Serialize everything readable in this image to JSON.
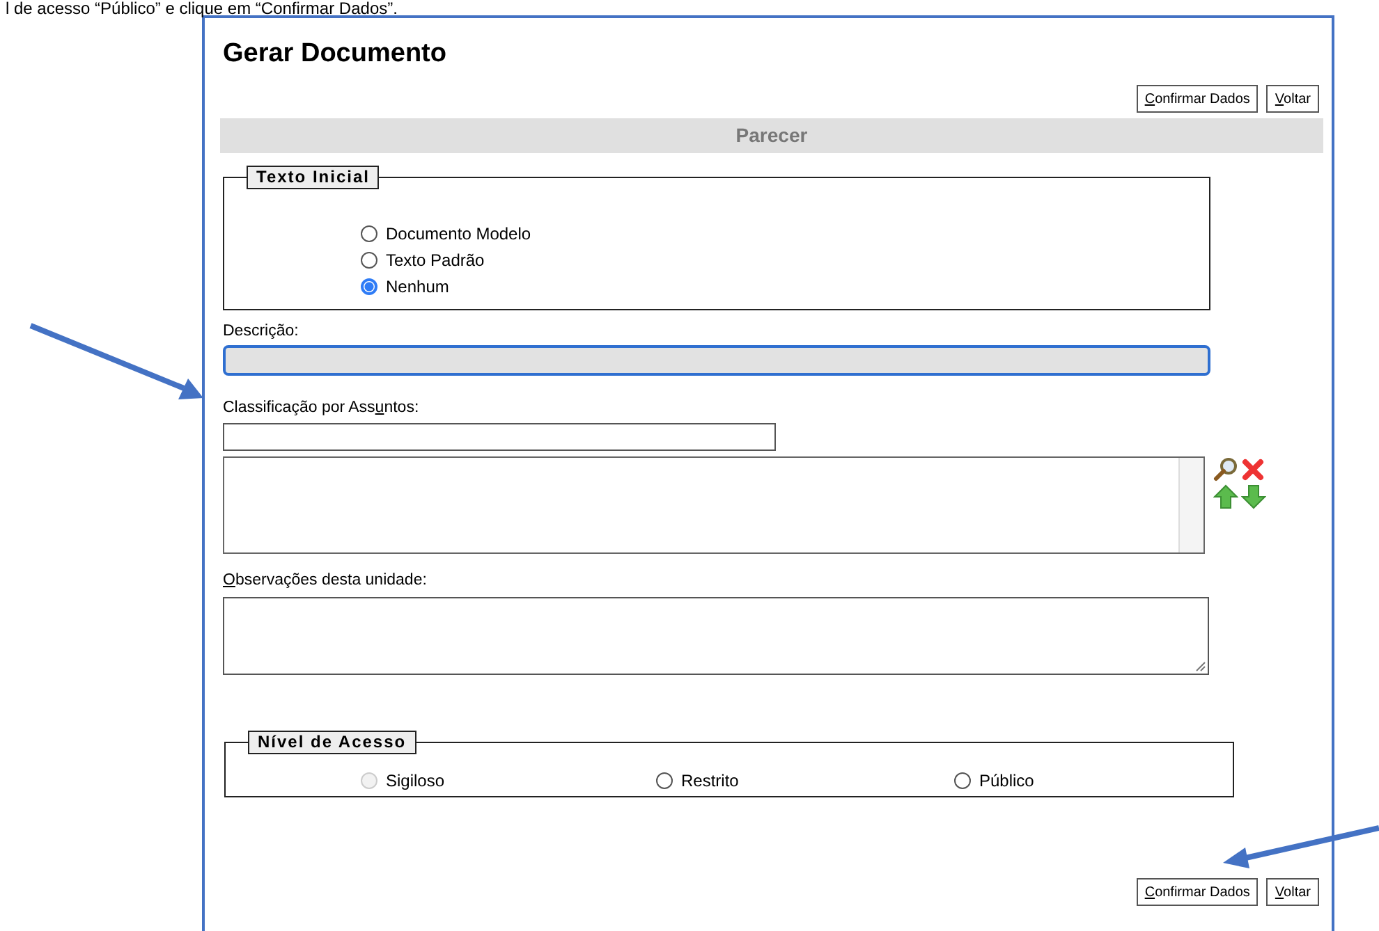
{
  "instruction_text": "l de acesso “Público” e clique em “Confirmar Dados”.",
  "window": {
    "title": "Gerar Documento"
  },
  "top_buttons": [
    {
      "key": "C",
      "after": "onfirmar Dados"
    },
    {
      "key": "V",
      "after": "oltar"
    }
  ],
  "section_header": "Parecer",
  "texto_inicial": {
    "legend": "Texto Inicial",
    "options": [
      {
        "label": "Documento Modelo",
        "selected": false
      },
      {
        "label": "Texto Padrão",
        "selected": false
      },
      {
        "label": "Nenhum",
        "selected": true
      }
    ]
  },
  "descricao": {
    "label": "Descrição:",
    "focused": true
  },
  "classificacao": {
    "label": {
      "before": "Classificação por Ass",
      "key": "u",
      "after": "ntos:"
    }
  },
  "observacoes": {
    "label": {
      "key": "O",
      "after": "bservações desta unidade:"
    }
  },
  "nivel_acesso": {
    "legend": "Nível de Acesso",
    "options": [
      {
        "label": "Sigiloso",
        "selected": false,
        "disabled": true
      },
      {
        "label": "Restrito",
        "selected": false,
        "disabled": false
      },
      {
        "label": "Público",
        "selected": false,
        "disabled": false
      }
    ]
  },
  "bottom_buttons": [
    {
      "key": "C",
      "after": "onfirmar Dados"
    },
    {
      "key": "V",
      "after": "oltar"
    }
  ]
}
